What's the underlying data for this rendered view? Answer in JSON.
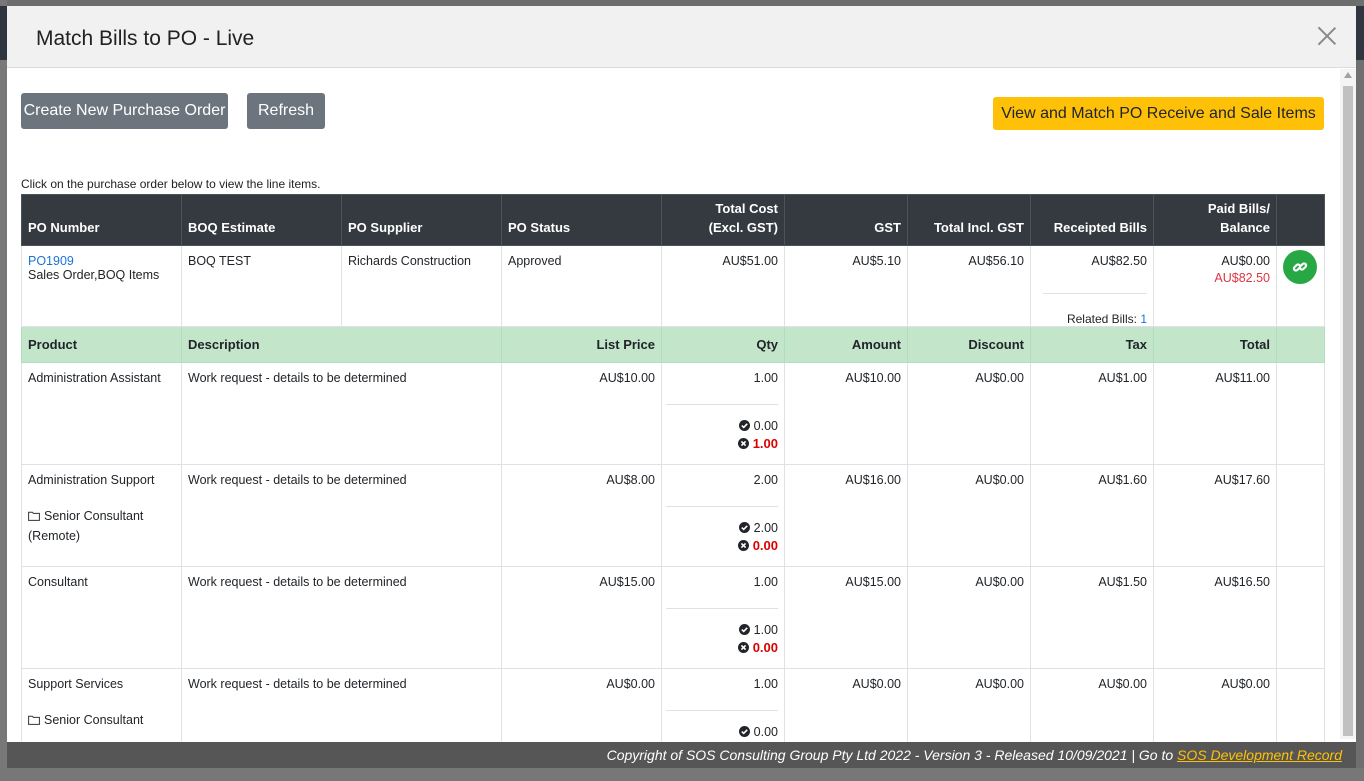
{
  "modal": {
    "title": "Match Bills to PO - Live"
  },
  "toolbar": {
    "create_label": "Create New Purchase Order",
    "refresh_label": "Refresh",
    "view_match_label": "View and Match PO Receive and Sale Items"
  },
  "hint": "Click on the purchase order below to view the line items.",
  "po_table": {
    "headers": {
      "po_number": "PO Number",
      "boq": "BOQ Estimate",
      "supplier": "PO Supplier",
      "status": "PO Status",
      "total_cost_1": "Total Cost",
      "total_cost_2": "(Excl. GST)",
      "gst": "GST",
      "total_incl": "Total Incl. GST",
      "receipted": "Receipted Bills",
      "paid": "Paid Bills/ Balance"
    },
    "row": {
      "po_number": "PO1909",
      "po_type": "Sales Order,BOQ Items",
      "boq": "BOQ TEST",
      "supplier": "Richards Construction",
      "status": "Approved",
      "total_cost": "AU$51.00",
      "gst": "AU$5.10",
      "total_incl": "AU$56.10",
      "receipted": "AU$82.50",
      "related_label": "Related Bills:",
      "related_count": "1",
      "paid": "AU$0.00",
      "balance": "AU$82.50"
    }
  },
  "items_table": {
    "headers": {
      "product": "Product",
      "description": "Description",
      "list_price": "List Price",
      "qty": "Qty",
      "amount": "Amount",
      "discount": "Discount",
      "tax": "Tax",
      "total": "Total"
    },
    "rows": [
      {
        "product": "Administration Assistant",
        "sub": "",
        "description": "Work request - details to be determined",
        "list_price": "AU$10.00",
        "qty": "1.00",
        "received": "0.00",
        "pending": "1.00",
        "amount": "AU$10.00",
        "discount": "AU$0.00",
        "tax": "AU$1.00",
        "total": "AU$11.00"
      },
      {
        "product": "Administration Support",
        "sub": "Senior Consultant (Remote)",
        "description": "Work request - details to be determined",
        "list_price": "AU$8.00",
        "qty": "2.00",
        "received": "2.00",
        "pending": "0.00",
        "amount": "AU$16.00",
        "discount": "AU$0.00",
        "tax": "AU$1.60",
        "total": "AU$17.60"
      },
      {
        "product": "Consultant",
        "sub": "",
        "description": "Work request - details to be determined",
        "list_price": "AU$15.00",
        "qty": "1.00",
        "received": "1.00",
        "pending": "0.00",
        "amount": "AU$15.00",
        "discount": "AU$0.00",
        "tax": "AU$1.50",
        "total": "AU$16.50"
      },
      {
        "product": "Support Services",
        "sub": "Senior Consultant",
        "description": "Work request - details to be determined",
        "list_price": "AU$0.00",
        "qty": "1.00",
        "received": "0.00",
        "pending": "",
        "amount": "AU$0.00",
        "discount": "AU$0.00",
        "tax": "AU$0.00",
        "total": "AU$0.00"
      }
    ]
  },
  "footer": {
    "text": "Copyright of SOS Consulting Group Pty Ltd 2022 - Version 3 - Released 10/09/2021 | Go to ",
    "link": "SOS Development Record"
  },
  "colors": {
    "header_dark": "#343a40",
    "subheader_green": "#c3e6cb",
    "link_blue": "#1b73d8",
    "danger_red": "#dc3545",
    "warning_yellow": "#ffc107",
    "secondary_gray": "#6c757d",
    "success_green": "#28a745"
  },
  "icons": {
    "close": "close-icon",
    "link": "link-icon",
    "received": "check-circle-icon",
    "pending": "x-circle-icon",
    "folder": "folder-icon"
  }
}
